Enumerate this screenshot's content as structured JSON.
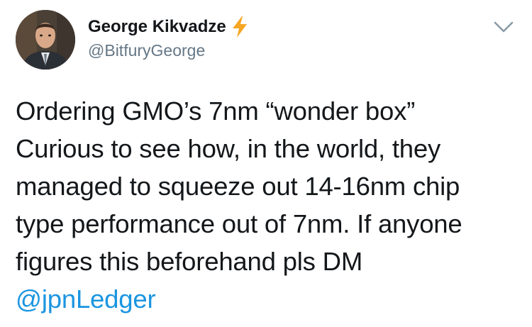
{
  "author": {
    "display_name": "George Kikvadze",
    "handle": "@BitfuryGeorge",
    "badge_icon": "lightning-bolt-icon",
    "badge_color": "#f5a623"
  },
  "menu": {
    "icon": "chevron-down-icon",
    "color": "#8899a6"
  },
  "tweet": {
    "lines": [
      "Ordering GMO’s 7nm “wonder box”",
      "Curious to see how, in the world, they",
      "managed to squeeze out 14-16nm chip",
      "type performance out of 7nm. If anyone",
      "figures this beforehand pls DM"
    ],
    "mention": "@jpnLedger",
    "mention_color": "#1b95e0"
  }
}
